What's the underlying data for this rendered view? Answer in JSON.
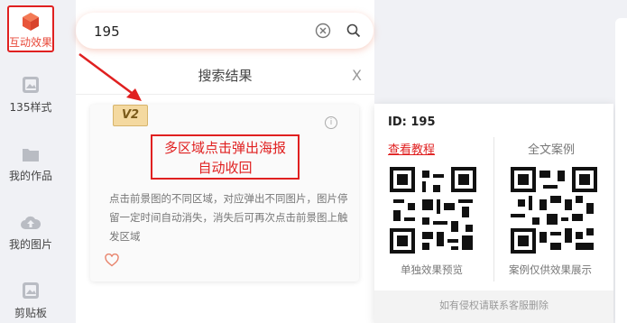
{
  "sidebar": {
    "items": [
      {
        "label": "互动效果",
        "icon": "cube-icon",
        "active": true
      },
      {
        "label": "135样式",
        "icon": "image-icon"
      },
      {
        "label": "我的作品",
        "icon": "folder-icon"
      },
      {
        "label": "我的图片",
        "icon": "cloud-upload-icon"
      },
      {
        "label": "剪贴板",
        "icon": "clipboard-icon"
      }
    ]
  },
  "search": {
    "value": "195",
    "placeholder": ""
  },
  "results": {
    "title": "搜索结果",
    "close": "X"
  },
  "card": {
    "badge": "V2",
    "title_line1": "多区域点击弹出海报",
    "title_line2": "自动收回",
    "description": "点击前景图的不同区域，对应弹出不同图片，图片停留一定时间自动消失，消失后可再次点击前景图上触发区域"
  },
  "popup": {
    "id_label": "ID: 195",
    "view_tutorial": "查看教程",
    "full_case": "全文案例",
    "caption_left": "单独效果预览",
    "caption_right": "案例仅供效果展示",
    "footer": "如有侵权请联系客服删除"
  },
  "colors": {
    "accent": "#e84b3c",
    "highlight_border": "#e02020"
  }
}
